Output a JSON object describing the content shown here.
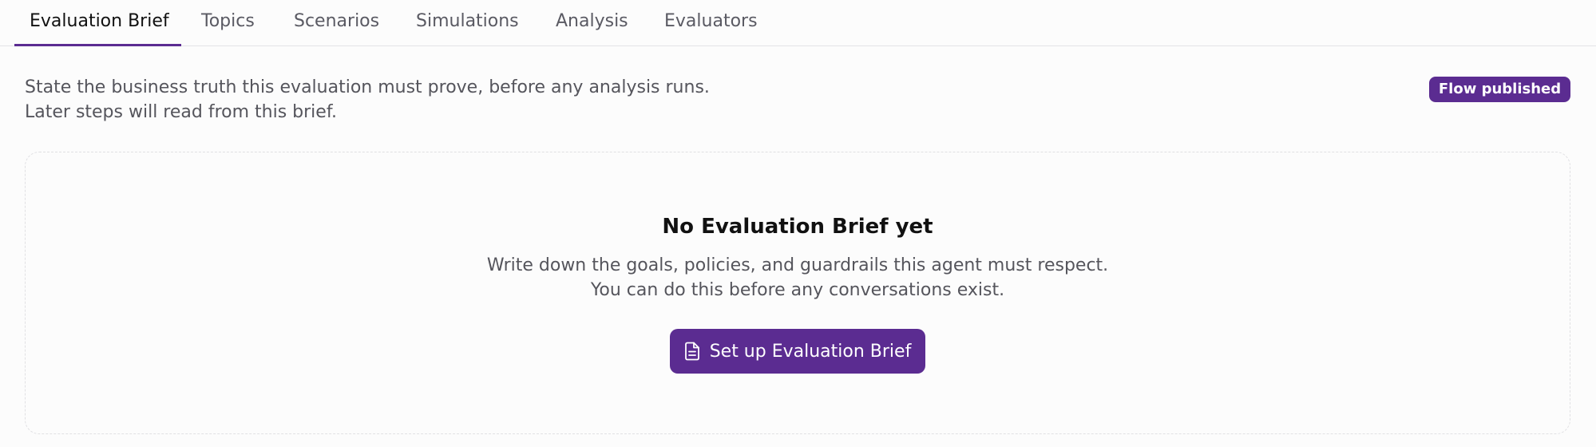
{
  "tabs": [
    {
      "label": "Evaluation Brief",
      "active": true
    },
    {
      "label": "Topics"
    },
    {
      "label": "Scenarios"
    },
    {
      "label": "Simulations"
    },
    {
      "label": "Analysis"
    },
    {
      "label": "Evaluators"
    }
  ],
  "intro": {
    "line1": "State the business truth this evaluation must prove, before any analysis runs.",
    "line2": "Later steps will read from this brief."
  },
  "status_badge": "Flow published",
  "empty_state": {
    "title": "No Evaluation Brief yet",
    "desc_line1": "Write down the goals, policies, and guardrails this agent must respect.",
    "desc_line2": "You can do this before any conversations exist.",
    "button_label": "Set up Evaluation Brief",
    "button_icon": "document-icon"
  },
  "colors": {
    "accent": "#5b2c91",
    "muted_text": "#55555c",
    "tab_text": "#5a5a63"
  }
}
